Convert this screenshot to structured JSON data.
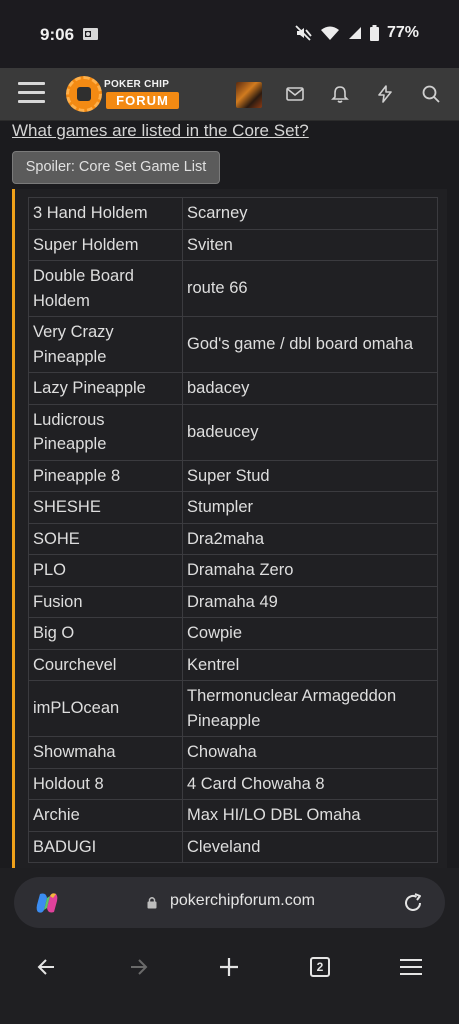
{
  "status_bar": {
    "time": "9:06",
    "battery": "77%",
    "icons": [
      "outlook-mail-icon",
      "mute-icon",
      "wifi-icon",
      "signal-icon",
      "battery-icon"
    ]
  },
  "header": {
    "logo_top": "POKER CHIP",
    "logo_bottom": "FORUM",
    "icons": [
      "menu-icon",
      "avatar",
      "mail-icon",
      "bell-icon",
      "lightning-icon",
      "search-icon"
    ],
    "accent_color": "#f38a13"
  },
  "content": {
    "faq_link": "What games are listed in the Core Set?",
    "spoiler_label": "Spoiler: Core Set Game List",
    "spoiler_accent": "#f0a11a",
    "games": [
      [
        "3 Hand Holdem",
        "Scarney"
      ],
      [
        "Super Holdem",
        "Sviten"
      ],
      [
        "Double Board Holdem",
        "route 66"
      ],
      [
        "Very Crazy Pineapple",
        "God's game / dbl board omaha"
      ],
      [
        "Lazy Pineapple",
        "badacey"
      ],
      [
        "Ludicrous Pineapple",
        "badeucey"
      ],
      [
        "Pineapple 8",
        "Super Stud"
      ],
      [
        "SHESHE",
        "Stumpler"
      ],
      [
        "SOHE",
        "Dra2maha"
      ],
      [
        "PLO",
        "Dramaha Zero"
      ],
      [
        "Fusion",
        "Dramaha 49"
      ],
      [
        "Big O",
        "Cowpie"
      ],
      [
        "Courchevel",
        "Kentrel"
      ],
      [
        "imPLOcean",
        "Thermonuclear Armageddon Pineapple"
      ],
      [
        "Showmaha",
        "Chowaha"
      ],
      [
        "Holdout 8",
        "4 Card Chowaha 8"
      ],
      [
        "Archie",
        "Max HI/LO DBL Omaha"
      ],
      [
        "BADUGI",
        "Cleveland"
      ]
    ]
  },
  "browser": {
    "url": "pokerchipforum.com",
    "tab_count": "2",
    "icons": [
      "copilot-icon",
      "lock-icon",
      "reload-icon",
      "back-icon",
      "forward-icon",
      "new-tab-icon",
      "tabs-icon",
      "menu-icon"
    ]
  }
}
